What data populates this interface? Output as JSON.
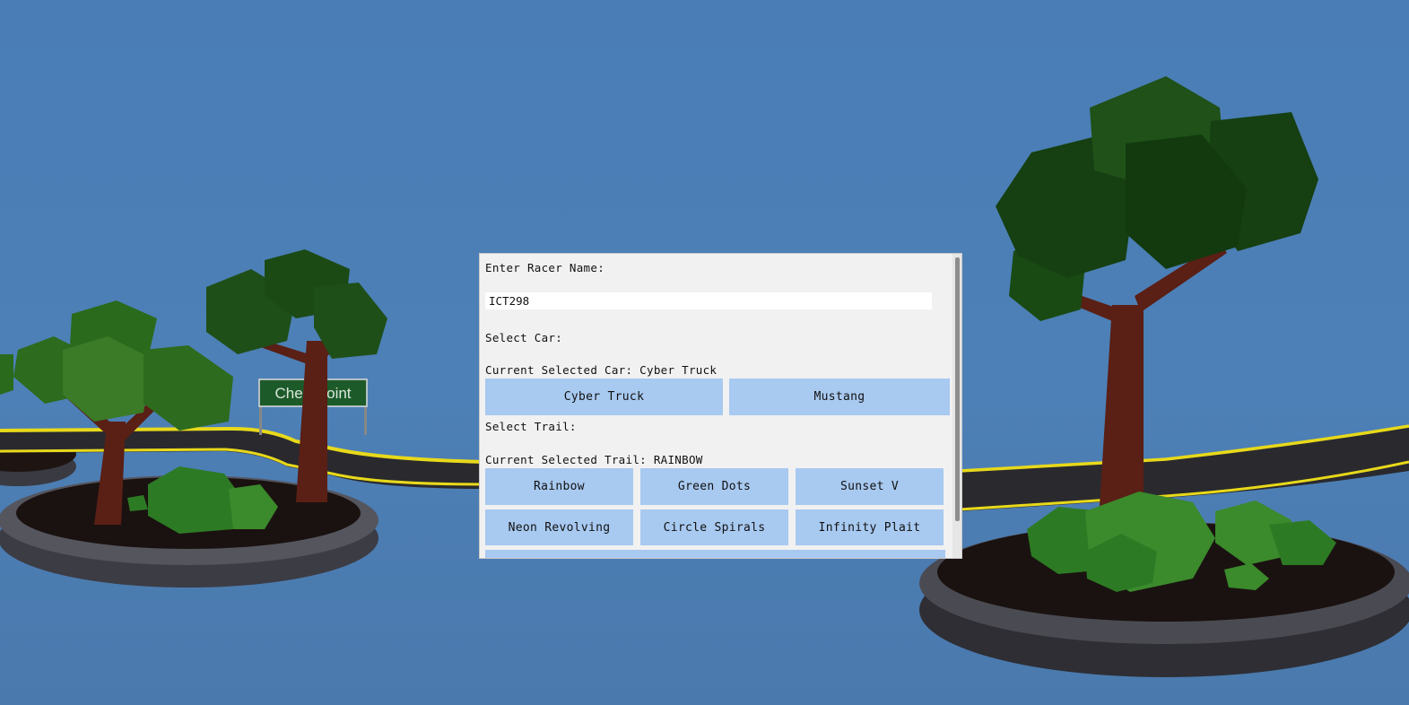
{
  "scene": {
    "checkpoint_sign": "Checkpoint",
    "sky_color": "#4a7db6"
  },
  "menu": {
    "name_label": "Enter Racer Name:",
    "name_value": "ICT298",
    "car_label": "Select Car:",
    "current_car": "Current Selected Car: Cyber Truck",
    "cars": [
      "Cyber Truck",
      "Mustang"
    ],
    "trail_label": "Select Trail:",
    "current_trail": "Current Selected Trail: RAINBOW",
    "trails": [
      "Rainbow",
      "Green Dots",
      "Sunset V",
      "Neon Revolving",
      "Circle Spirals",
      "Infinity Plait"
    ],
    "button_color": "#a8c9f0"
  }
}
